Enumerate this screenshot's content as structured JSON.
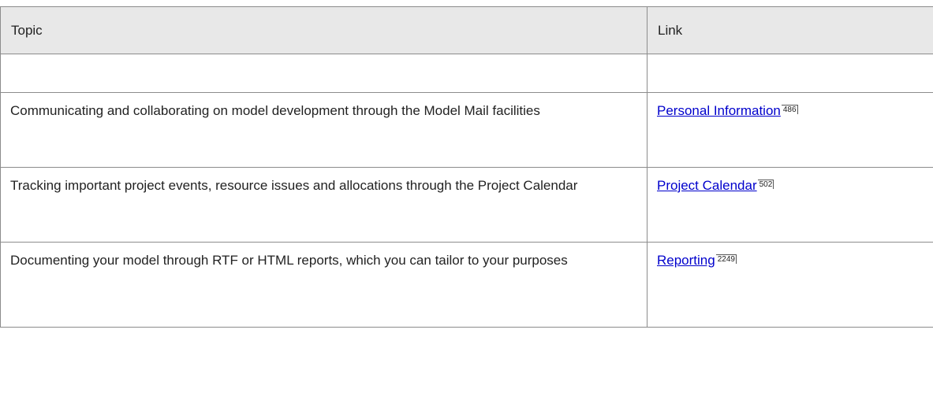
{
  "table": {
    "headers": {
      "topic": "Topic",
      "link": "Link"
    },
    "rows": [
      {
        "topic": "",
        "link": "",
        "page": ""
      },
      {
        "topic": "Communicating and collaborating on model development through the Model Mail facilities",
        "link": "Personal Information",
        "page": "486"
      },
      {
        "topic": "Tracking important project events, resource issues and allocations through the Project Calendar",
        "link": "Project Calendar",
        "page": "502"
      },
      {
        "topic": "Documenting your model through RTF or HTML reports, which you can tailor to your purposes",
        "link": "Reporting",
        "page": "2249"
      }
    ]
  }
}
